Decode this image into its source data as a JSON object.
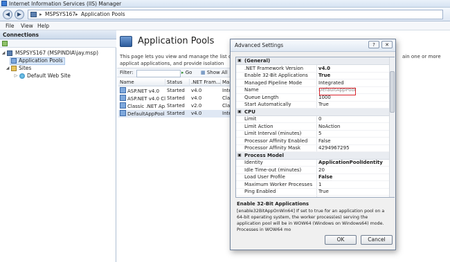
{
  "window": {
    "title": "Internet Information Services (IIS) Manager"
  },
  "address": {
    "segments": [
      "MSPSYS167",
      "Application Pools"
    ]
  },
  "menu": [
    "File",
    "View",
    "Help"
  ],
  "connections": {
    "header": "Connections",
    "tree": {
      "server": "MSPSYS167 (MSPINDIA\\jay.msp)",
      "app_pools": "Application Pools",
      "sites": "Sites",
      "default_site": "Default Web Site"
    }
  },
  "main": {
    "title": "Application Pools",
    "description": "This page lets you view and manage the list of applicat applications, and provide isolation among different app",
    "description_right": "ain one or more",
    "filter": {
      "label": "Filter:",
      "go": "Go",
      "show_all": "Show All"
    },
    "columns": [
      "Name",
      "Status",
      ".NET Fram...",
      "Mar"
    ],
    "rows": [
      {
        "name": "ASP.NET v4.0",
        "status": "Started",
        "net": "v4.0",
        "mode": "Inte"
      },
      {
        "name": "ASP.NET v4.0 Cl...",
        "status": "Started",
        "net": "v4.0",
        "mode": "Clas"
      },
      {
        "name": "Classic .NET Ap...",
        "status": "Started",
        "net": "v2.0",
        "mode": "Clas"
      },
      {
        "name": "DefaultAppPool",
        "status": "Started",
        "net": "v4.0",
        "mode": "Inte"
      }
    ]
  },
  "dialog": {
    "title": "Advanced Settings",
    "help_label": "?",
    "close_label": "✕",
    "categories": [
      {
        "name": "(General)",
        "props": [
          {
            "name": ".NET Framework Version",
            "value": "v4.0",
            "style": "bold"
          },
          {
            "name": "Enable 32-Bit Applications",
            "value": "True",
            "style": "bold"
          },
          {
            "name": "Managed Pipeline Mode",
            "value": "Integrated",
            "style": ""
          },
          {
            "name": "Name",
            "value": "DefaultAppPool",
            "style": "gray"
          },
          {
            "name": "Queue Length",
            "value": "1000",
            "style": ""
          },
          {
            "name": "Start Automatically",
            "value": "True",
            "style": ""
          }
        ]
      },
      {
        "name": "CPU",
        "props": [
          {
            "name": "Limit",
            "value": "0",
            "style": ""
          },
          {
            "name": "Limit Action",
            "value": "NoAction",
            "style": ""
          },
          {
            "name": "Limit Interval (minutes)",
            "value": "5",
            "style": ""
          },
          {
            "name": "Processor Affinity Enabled",
            "value": "False",
            "style": ""
          },
          {
            "name": "Processor Affinity Mask",
            "value": "4294967295",
            "style": ""
          }
        ]
      },
      {
        "name": "Process Model",
        "props": [
          {
            "name": "Identity",
            "value": "ApplicationPoolIdentity",
            "style": "bold"
          },
          {
            "name": "Idle Time-out (minutes)",
            "value": "20",
            "style": ""
          },
          {
            "name": "Load User Profile",
            "value": "False",
            "style": "bold"
          },
          {
            "name": "Maximum Worker Processes",
            "value": "1",
            "style": ""
          },
          {
            "name": "Ping Enabled",
            "value": "True",
            "style": ""
          }
        ]
      }
    ],
    "desc_title": "Enable 32-Bit Applications",
    "desc_text": "[enable32BitAppOnWin64] If set to true for an application pool on a 64-bit operating system, the worker process(es) serving the application pool will be in WOW64 (Windows on Windows64) mode. Processes in WOW64 mo",
    "ok": "OK",
    "cancel": "Cancel"
  },
  "colors": {
    "accent": "#3a7bd5",
    "highlight_box": "#d9232b",
    "selection": "#d7e6f8"
  }
}
